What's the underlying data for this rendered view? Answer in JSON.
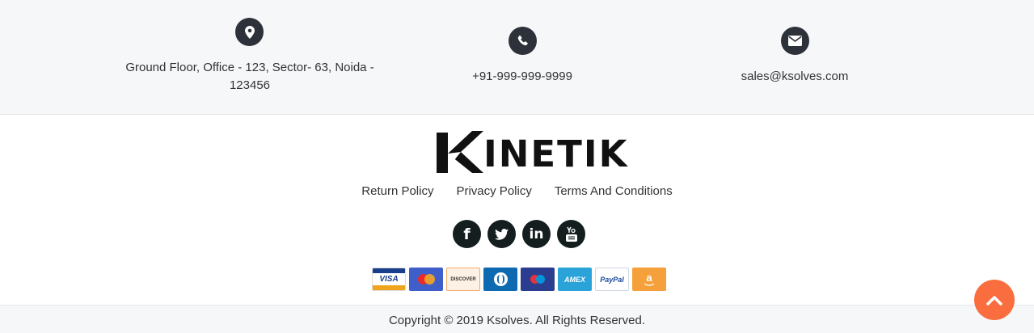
{
  "contact": {
    "address": "Ground Floor, Office - 123, Sector- 63, Noida - 123456",
    "phone": "+91-999-999-9999",
    "email": "sales@ksolves.com"
  },
  "logo": {
    "word": "INETIK"
  },
  "policies": {
    "return": "Return Policy",
    "privacy": "Privacy Policy",
    "terms": "Terms And Conditions"
  },
  "social": {
    "facebook": "f",
    "linkedin": "in"
  },
  "payments": {
    "visa": "VISA",
    "discover": "DISCOVER",
    "amex": "AMEX",
    "paypal": "PayPal",
    "amazon": "a"
  },
  "footer": {
    "copyright": "Copyright © 2019 Ksolves. All Rights Reserved."
  },
  "icons": [
    "map-marker-icon",
    "phone-icon",
    "envelope-icon",
    "facebook-icon",
    "twitter-icon",
    "linkedin-icon",
    "youtube-icon",
    "chevron-up-icon"
  ],
  "colors": {
    "strip_bg": "#f5f7f8",
    "icon_bg": "#2d3139",
    "social_bg": "#141e1e",
    "accent": "#f96d3e"
  }
}
